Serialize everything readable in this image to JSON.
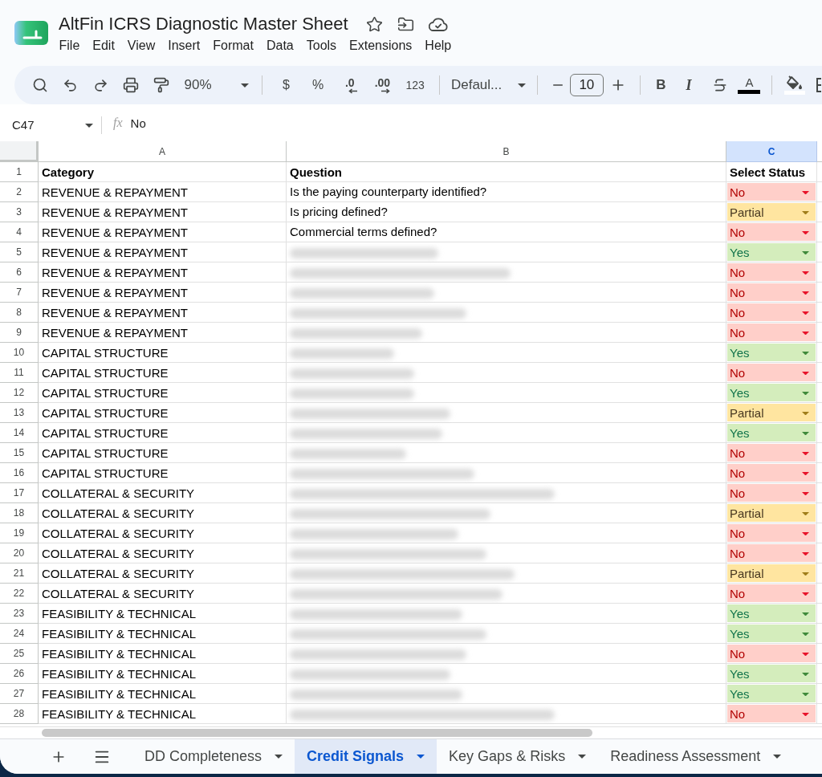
{
  "document": {
    "title": "AltFin ICRS Diagnostic Master Sheet"
  },
  "menu": [
    "File",
    "Edit",
    "View",
    "Insert",
    "Format",
    "Data",
    "Tools",
    "Extensions",
    "Help"
  ],
  "toolbar": {
    "zoom": "90%",
    "currency": "$",
    "percent": "%",
    "decrease_decimals": ".0",
    "increase_decimals": ".00",
    "more_formats": "123",
    "font": "Defaul...",
    "font_size": "10",
    "bold": "B",
    "italic": "I",
    "text_color": "A"
  },
  "formula_bar": {
    "cell_ref": "C47",
    "function_label": "fx",
    "formula": "No"
  },
  "columns": [
    {
      "label": "A",
      "selected": false
    },
    {
      "label": "B",
      "selected": false
    },
    {
      "label": "C",
      "selected": true
    }
  ],
  "header_row": {
    "number": "1",
    "cells": [
      "Category",
      "Question",
      "Select Status"
    ]
  },
  "rows": [
    {
      "number": "2",
      "category": "REVENUE & REPAYMENT",
      "question": "Is the paying counterparty identified?",
      "redacted": false,
      "status": "No",
      "color": "#ffcfc9"
    },
    {
      "number": "3",
      "category": "REVENUE & REPAYMENT",
      "question": "Is pricing defined?",
      "redacted": false,
      "status": "Partial",
      "color": "#ffe5a0"
    },
    {
      "number": "4",
      "category": "REVENUE & REPAYMENT",
      "question": "Commercial terms defined?",
      "redacted": false,
      "status": "No",
      "color": "#ffcfc9"
    },
    {
      "number": "5",
      "category": "REVENUE & REPAYMENT",
      "redacted": true,
      "status": "Yes",
      "color": "#d4edbc"
    },
    {
      "number": "6",
      "category": "REVENUE & REPAYMENT",
      "redacted": true,
      "status": "No",
      "color": "#ffcfc9"
    },
    {
      "number": "7",
      "category": "REVENUE & REPAYMENT",
      "redacted": true,
      "status": "No",
      "color": "#ffcfc9"
    },
    {
      "number": "8",
      "category": "REVENUE & REPAYMENT",
      "redacted": true,
      "status": "No",
      "color": "#ffcfc9"
    },
    {
      "number": "9",
      "category": "REVENUE & REPAYMENT",
      "redacted": true,
      "status": "No",
      "color": "#ffcfc9"
    },
    {
      "number": "10",
      "category": "CAPITAL STRUCTURE",
      "redacted": true,
      "status": "Yes",
      "color": "#d4edbc"
    },
    {
      "number": "11",
      "category": "CAPITAL STRUCTURE",
      "redacted": true,
      "status": "No",
      "color": "#ffcfc9"
    },
    {
      "number": "12",
      "category": "CAPITAL STRUCTURE",
      "redacted": true,
      "status": "Yes",
      "color": "#d4edbc"
    },
    {
      "number": "13",
      "category": "CAPITAL STRUCTURE",
      "redacted": true,
      "status": "Partial",
      "color": "#ffe5a0"
    },
    {
      "number": "14",
      "category": "CAPITAL STRUCTURE",
      "redacted": true,
      "status": "Yes",
      "color": "#d4edbc"
    },
    {
      "number": "15",
      "category": "CAPITAL STRUCTURE",
      "redacted": true,
      "status": "No",
      "color": "#ffcfc9"
    },
    {
      "number": "16",
      "category": "CAPITAL STRUCTURE",
      "redacted": true,
      "status": "No",
      "color": "#ffcfc9"
    },
    {
      "number": "17",
      "category": "COLLATERAL & SECURITY",
      "redacted": true,
      "status": "No",
      "color": "#ffcfc9"
    },
    {
      "number": "18",
      "category": "COLLATERAL & SECURITY",
      "redacted": true,
      "status": "Partial",
      "color": "#ffe5a0"
    },
    {
      "number": "19",
      "category": "COLLATERAL & SECURITY",
      "redacted": true,
      "status": "No",
      "color": "#ffcfc9"
    },
    {
      "number": "20",
      "category": "COLLATERAL & SECURITY",
      "redacted": true,
      "status": "No",
      "color": "#ffcfc9"
    },
    {
      "number": "21",
      "category": "COLLATERAL & SECURITY",
      "redacted": true,
      "status": "Partial",
      "color": "#ffe5a0"
    },
    {
      "number": "22",
      "category": "COLLATERAL & SECURITY",
      "redacted": true,
      "status": "No",
      "color": "#ffcfc9"
    },
    {
      "number": "23",
      "category": "FEASIBILITY & TECHNICAL",
      "redacted": true,
      "status": "Yes",
      "color": "#d4edbc"
    },
    {
      "number": "24",
      "category": "FEASIBILITY & TECHNICAL",
      "redacted": true,
      "status": "Yes",
      "color": "#d4edbc"
    },
    {
      "number": "25",
      "category": "FEASIBILITY & TECHNICAL",
      "redacted": true,
      "status": "No",
      "color": "#ffcfc9"
    },
    {
      "number": "26",
      "category": "FEASIBILITY & TECHNICAL",
      "redacted": true,
      "status": "Yes",
      "color": "#d4edbc"
    },
    {
      "number": "27",
      "category": "FEASIBILITY & TECHNICAL",
      "redacted": true,
      "status": "Yes",
      "color": "#d4edbc"
    },
    {
      "number": "28",
      "category": "FEASIBILITY & TECHNICAL",
      "redacted": true,
      "status": "No",
      "color": "#ffcfc9"
    }
  ],
  "sheet_tabs": [
    {
      "label": "DD Completeness",
      "selected": false
    },
    {
      "label": "Credit Signals",
      "selected": true
    },
    {
      "label": "Key Gaps & Risks",
      "selected": false
    },
    {
      "label": "Readiness Assessment",
      "selected": false
    }
  ]
}
